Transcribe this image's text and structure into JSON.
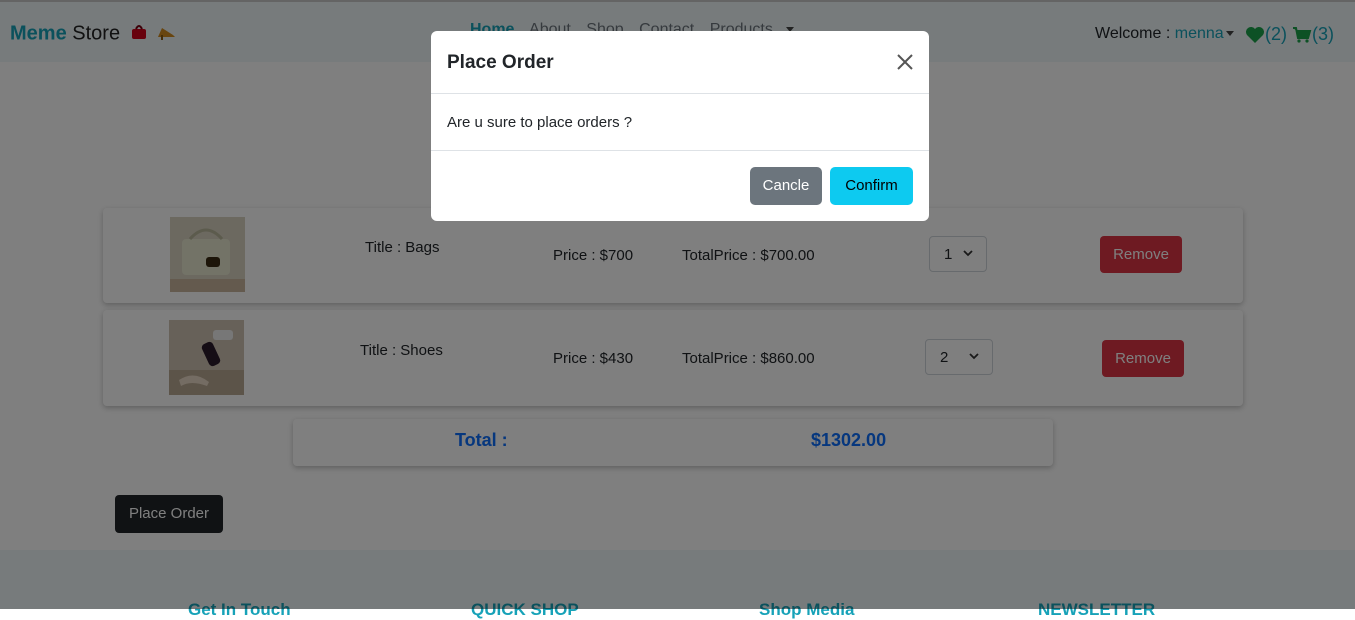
{
  "navbar": {
    "brand_part1": "Meme",
    "brand_part2": "Store",
    "links": [
      "Home",
      "About",
      "Shop",
      "Contact",
      "Products"
    ],
    "welcome_label": "Welcome :",
    "username": "menna",
    "wishlist_count": "(2)",
    "cart_count": "(3)"
  },
  "cart": {
    "items": [
      {
        "title": "Title : Bags",
        "price": "Price : $700",
        "total": "TotalPrice : $700.00",
        "qty": "1",
        "remove_label": "Remove"
      },
      {
        "title": "Title : Shoes",
        "price": "Price : $430",
        "total": "TotalPrice : $860.00",
        "qty": "2",
        "remove_label": "Remove"
      }
    ],
    "total_label": "Total :",
    "total_amount": "$1302.00",
    "place_order_label": "Place Order"
  },
  "footer": {
    "sections": [
      "Get In Touch",
      "QUICK SHOP",
      "Shop Media",
      "NEWSLETTER"
    ]
  },
  "modal": {
    "title": "Place Order",
    "message": "Are u sure to place orders ?",
    "cancel_label": "Cancle",
    "confirm_label": "Confirm"
  },
  "colors": {
    "accent": "#17a2b8",
    "danger": "#dc3545",
    "confirm": "#0dcaf0",
    "total_text": "#0d6efd"
  }
}
